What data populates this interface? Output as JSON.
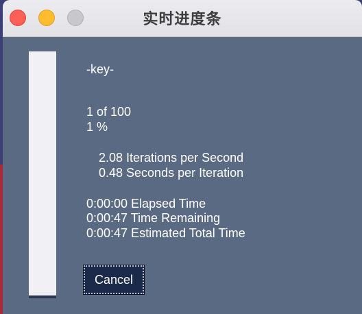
{
  "window": {
    "title": "实时进度条"
  },
  "progress": {
    "key": "-key-",
    "count_text": "1 of 100",
    "percent_text": "1 %",
    "fraction": 0.01,
    "iterations_per_second": "2.08 Iterations per Second",
    "seconds_per_iteration": "0.48 Seconds per Iteration",
    "elapsed": "0:00:00 Elapsed Time",
    "remaining": "0:00:47 Time Remaining",
    "estimated_total": "0:00:47 Estimated Total Time"
  },
  "buttons": {
    "cancel_label": "Cancel"
  },
  "colors": {
    "close": "#fe5f57",
    "minimize": "#febc2e",
    "zoom": "#c8c7cc",
    "window_bg": "#5a6a82",
    "bar_track": "#f0f0f5",
    "bar_fill": "#2b3553"
  }
}
